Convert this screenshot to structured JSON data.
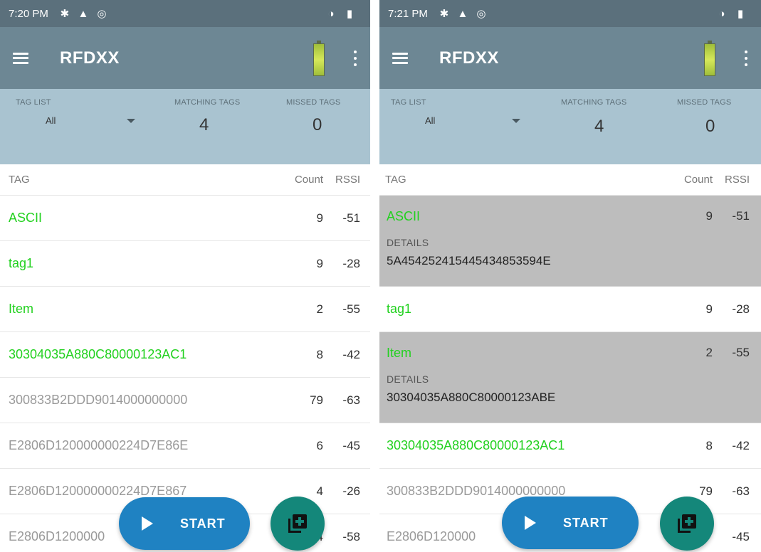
{
  "left": {
    "status": {
      "time": "7:20 PM"
    },
    "app_bar": {
      "title": "RFDXX"
    },
    "filter": {
      "tag_list_label": "TAG LIST",
      "tag_list_value": "All",
      "matching_label": "MATCHING TAGS",
      "matching_value": "4",
      "missed_label": "MISSED TAGS",
      "missed_value": "0"
    },
    "list_header": {
      "tag": "TAG",
      "count": "Count",
      "rssi": "RSSI"
    },
    "rows": [
      {
        "tag": "ASCII",
        "count": "9",
        "rssi": "-51"
      },
      {
        "tag": "tag1",
        "count": "9",
        "rssi": "-28"
      },
      {
        "tag": "Item",
        "count": "2",
        "rssi": "-55"
      },
      {
        "tag": "30304035A880C80000123AC1",
        "count": "8",
        "rssi": "-42"
      },
      {
        "tag": "300833B2DDD9014000000000",
        "count": "79",
        "rssi": "-63"
      },
      {
        "tag": "E2806D120000000224D7E86E",
        "count": "6",
        "rssi": "-45"
      },
      {
        "tag": "E2806D120000000224D7E867",
        "count": "4",
        "rssi": "-26"
      },
      {
        "tag": "E2806D1200000",
        "count": "4",
        "rssi": "-58"
      }
    ],
    "fab": {
      "start_label": "START"
    }
  },
  "right": {
    "status": {
      "time": "7:21 PM"
    },
    "app_bar": {
      "title": "RFDXX"
    },
    "filter": {
      "tag_list_label": "TAG LIST",
      "tag_list_value": "All",
      "matching_label": "MATCHING TAGS",
      "matching_value": "4",
      "missed_label": "MISSED TAGS",
      "missed_value": "0"
    },
    "list_header": {
      "tag": "TAG",
      "count": "Count",
      "rssi": "RSSI"
    },
    "rows": [
      {
        "tag": "ASCII",
        "count": "9",
        "rssi": "-51",
        "details_label": "DETAILS",
        "details_value": "5A454252415445434853594E"
      },
      {
        "tag": "tag1",
        "count": "9",
        "rssi": "-28"
      },
      {
        "tag": "Item",
        "count": "2",
        "rssi": "-55",
        "details_label": "DETAILS",
        "details_value": "30304035A880C80000123ABE"
      },
      {
        "tag": "30304035A880C80000123AC1",
        "count": "8",
        "rssi": "-42"
      },
      {
        "tag": "300833B2DDD9014000000000",
        "count": "79",
        "rssi": "-63"
      },
      {
        "tag": "E2806D120000",
        "count": "",
        "rssi": "-45"
      }
    ],
    "fab": {
      "start_label": "START"
    }
  },
  "colors": {
    "status_bar": "#5b707c",
    "app_bar": "#6d8794",
    "filter_panel": "#a9c3d0",
    "matched_tag": "#22d11f",
    "unmatched_tag": "#9a9a9a",
    "start_button": "#1f82c2",
    "add_button": "#14877a",
    "expanded_row": "#bdbdbd"
  },
  "icons": {
    "status": [
      "settings-icon",
      "warning-icon",
      "sync-icon",
      "vpn-icon",
      "battery-status-icon"
    ],
    "app_bar": [
      "menu-icon",
      "battery-level-icon",
      "overflow-menu-icon"
    ],
    "fab": [
      "play-icon",
      "add-to-list-icon"
    ]
  }
}
